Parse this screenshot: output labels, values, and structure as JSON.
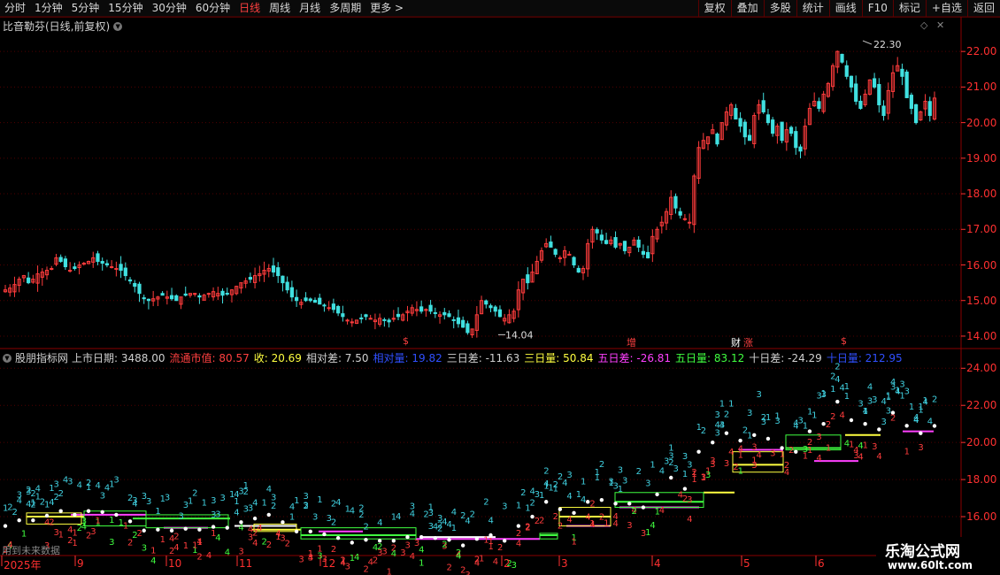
{
  "toolbar": {
    "periods": [
      "分时",
      "1分钟",
      "5分钟",
      "15分钟",
      "30分钟",
      "60分钟",
      "日线",
      "周线",
      "月线",
      "多周期",
      "更多 >"
    ],
    "active": "日线",
    "buttons": [
      "复权",
      "叠加",
      "多股",
      "统计",
      "画线",
      "F10",
      "标记",
      "+自选",
      "返回"
    ]
  },
  "main_chart": {
    "title": "比音勒芬(日线,前复权)",
    "high_label": "22.30",
    "low_label": "14.04",
    "y_ticks": [
      "22.00",
      "21.00",
      "20.00",
      "19.00",
      "18.00",
      "17.00",
      "16.00",
      "15.00",
      "14.00"
    ],
    "markers": [
      {
        "text": "$",
        "x": 455,
        "color": "#ff4040"
      },
      {
        "text": "增",
        "x": 708,
        "color": "#ff4040"
      },
      {
        "text": "财",
        "x": 826,
        "color": "#ffffff"
      },
      {
        "text": "涨",
        "x": 840,
        "color": "#ff4040"
      },
      {
        "text": "$",
        "x": 950,
        "color": "#ff4040"
      }
    ]
  },
  "indicator": {
    "name": "股朋指标网",
    "fields": [
      {
        "label": "上市日期:",
        "value": "3488.00",
        "color": "#d0d0d0"
      },
      {
        "label": "流通市值:",
        "value": "80.57",
        "color": "#ff4040"
      },
      {
        "label": "收:",
        "value": "20.69",
        "color": "#ffff40"
      },
      {
        "label": "相对差:",
        "value": "7.50",
        "color": "#d0d0d0"
      },
      {
        "label": "相对量:",
        "value": "19.82",
        "color": "#3050ff"
      },
      {
        "label": "三日差:",
        "value": "-11.63",
        "color": "#d0d0d0"
      },
      {
        "label": "三日量:",
        "value": "50.84",
        "color": "#ffff40"
      },
      {
        "label": "五日差:",
        "value": "-26.81",
        "color": "#ff40ff"
      },
      {
        "label": "五日量:",
        "value": "83.12",
        "color": "#40ff40"
      },
      {
        "label": "十日差:",
        "value": "-24.29",
        "color": "#d0d0d0"
      },
      {
        "label": "十日量:",
        "value": "212.95",
        "color": "#3050ff"
      }
    ],
    "y_ticks": [
      "24.00",
      "22.00",
      "20.00",
      "18.00",
      "16.00"
    ]
  },
  "x_axis": [
    "2025年",
    "9",
    "10",
    "11",
    "12",
    "2",
    "3",
    "4",
    "5",
    "6"
  ],
  "future_text": "用到未来数据",
  "watermark": {
    "line1": "乐淘公式网",
    "line2": "www.60lt.com"
  },
  "chart_data": {
    "type": "candlestick",
    "title": "比音勒芬(日线,前复权)",
    "ylim": [
      13.8,
      22.7
    ],
    "max_label": 22.3,
    "min_label": 14.04,
    "month_labels": [
      "2025年",
      "9",
      "10",
      "11",
      "12",
      "2",
      "3",
      "4",
      "5",
      "6"
    ],
    "close": [
      15.3,
      15.35,
      15.45,
      15.6,
      15.7,
      15.5,
      15.6,
      15.75,
      15.8,
      15.85,
      15.9,
      16.2,
      16.1,
      15.95,
      15.85,
      15.9,
      16.0,
      16.05,
      16.1,
      16.2,
      16.1,
      16.05,
      16.0,
      15.95,
      15.9,
      15.85,
      15.7,
      15.55,
      15.4,
      15.2,
      15.05,
      15.0,
      15.05,
      15.1,
      15.15,
      15.1,
      15.05,
      15.0,
      15.1,
      15.15,
      15.2,
      15.2,
      15.1,
      15.15,
      15.2,
      15.25,
      15.2,
      15.15,
      15.2,
      15.3,
      15.4,
      15.5,
      15.55,
      15.6,
      15.7,
      15.75,
      15.85,
      15.9,
      15.8,
      15.7,
      15.5,
      15.3,
      15.1,
      15.0,
      14.95,
      15.0,
      15.0,
      14.95,
      14.9,
      14.85,
      14.8,
      14.75,
      14.65,
      14.55,
      14.45,
      14.4,
      14.45,
      14.5,
      14.55,
      14.5,
      14.45,
      14.5,
      14.45,
      14.4,
      14.5,
      14.55,
      14.6,
      14.7,
      14.8,
      14.75,
      14.7,
      14.75,
      14.7,
      14.65,
      14.6,
      14.6,
      14.55,
      14.45,
      14.35,
      14.25,
      14.1,
      14.2,
      14.6,
      15.0,
      14.9,
      14.8,
      14.7,
      14.55,
      14.5,
      14.6,
      14.7,
      15.3,
      15.6,
      15.5,
      15.8,
      16.1,
      16.4,
      16.6,
      16.5,
      16.3,
      16.2,
      16.4,
      16.3,
      16.0,
      15.8,
      15.9,
      16.6,
      17.0,
      16.9,
      16.7,
      16.6,
      16.7,
      16.5,
      16.6,
      16.4,
      16.5,
      16.7,
      16.5,
      16.3,
      16.2,
      16.8,
      17.0,
      17.2,
      17.5,
      17.9,
      17.6,
      17.4,
      17.3,
      17.2,
      18.5,
      19.3,
      19.5,
      19.6,
      19.8,
      19.4,
      20.0,
      20.3,
      20.5,
      20.1,
      19.9,
      19.6,
      19.5,
      20.2,
      20.5,
      20.3,
      20.0,
      19.7,
      19.9,
      19.5,
      19.8,
      19.7,
      19.3,
      19.2,
      19.9,
      20.4,
      20.6,
      20.4,
      20.8,
      21.1,
      21.6,
      22.0,
      21.7,
      21.3,
      21.0,
      20.6,
      20.4,
      20.8,
      21.2,
      21.0,
      20.5,
      20.2,
      20.9,
      21.4,
      21.6,
      21.3,
      20.7,
      20.4,
      20.0,
      20.3,
      20.6,
      20.2,
      20.69
    ]
  }
}
